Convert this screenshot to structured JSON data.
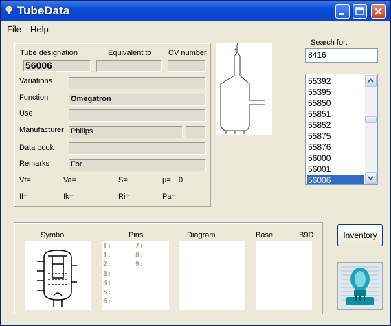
{
  "window": {
    "title": "TubeData"
  },
  "menu": {
    "file": "File",
    "help": "Help"
  },
  "header_labels": {
    "designation": "Tube designation",
    "equivalent": "Equivalent to",
    "cv": "CV number"
  },
  "fields": {
    "designation": "56006",
    "variations_label": "Variations",
    "function_label": "Function",
    "function_value": "Omegatron",
    "use_label": "Use",
    "manufacturer_label": "Manufacturer",
    "manufacturer_value": "Philips",
    "databook_label": "Data book",
    "remarks_label": "Remarks",
    "remarks_value": "For"
  },
  "params": {
    "vf": "Vf=",
    "va": "Va=",
    "s": "S=",
    "mu": "μ=",
    "mu_value": "0",
    "if": "If=",
    "ik": "Ik=",
    "ri": "Ri=",
    "pa": "Pa="
  },
  "search": {
    "label": "Search for:",
    "value": "8416"
  },
  "tube_list": [
    "55392",
    "55395",
    "55850",
    "55851",
    "55852",
    "55875",
    "55876",
    "56000",
    "56001",
    "56006"
  ],
  "selected_tube": "56006",
  "bottom_labels": {
    "symbol": "Symbol",
    "pins": "Pins",
    "diagram": "Diagram",
    "base": "Base",
    "base_value": "B9D"
  },
  "pins": {
    "left": [
      "T:",
      "1:",
      "2:",
      "3:",
      "4:",
      "5:",
      "6:"
    ],
    "right": [
      "7:",
      "8:",
      "9:"
    ]
  },
  "buttons": {
    "inventory": "Inventory"
  },
  "colors": {
    "titlebar": "#0846c8",
    "selection": "#316ac5",
    "face": "#ece9d8"
  }
}
